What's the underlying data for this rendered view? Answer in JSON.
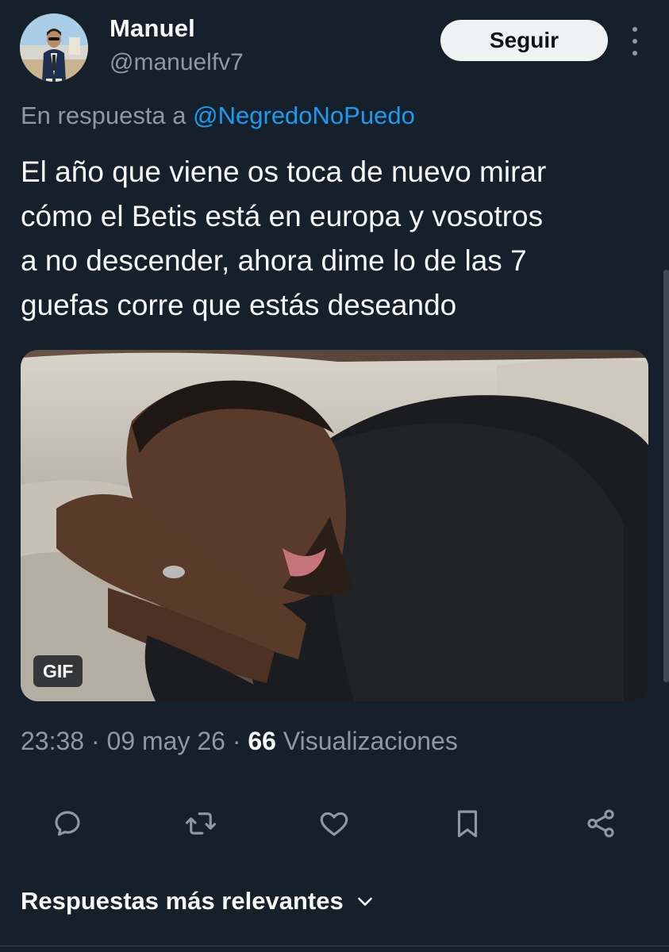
{
  "author": {
    "display_name": "Manuel",
    "handle": "@manuelfv7"
  },
  "follow_button_label": "Seguir",
  "more_options_icon": "more-vertical-icon",
  "reply_context": {
    "prefix": "En respuesta a",
    "mention": "@NegredoNoPuedo"
  },
  "tweet_text_lines": [
    "El año que viene os toca de nuevo mirar",
    "cómo el Betis está en europa y vosotros",
    "a no descender, ahora dime lo de las 7",
    "guefas corre que estás deseando"
  ],
  "media": {
    "badge": "GIF"
  },
  "meta": {
    "time": "23:38",
    "separator": "·",
    "date": "09 may 26",
    "views_count": "66",
    "views_label": "Visualizaciones"
  },
  "actions": [
    {
      "icon": "reply-icon"
    },
    {
      "icon": "retweet-icon"
    },
    {
      "icon": "like-icon"
    },
    {
      "icon": "bookmark-icon"
    },
    {
      "icon": "share-icon"
    }
  ],
  "replies_sort": {
    "label": "Respuestas más relevantes",
    "icon": "chevron-down-icon"
  },
  "colors": {
    "background": "#15202b",
    "text_primary": "#f7f9f9",
    "text_secondary": "#8b98a5",
    "link": "#1d9bf0",
    "follow_button_bg": "#eff3f4"
  }
}
